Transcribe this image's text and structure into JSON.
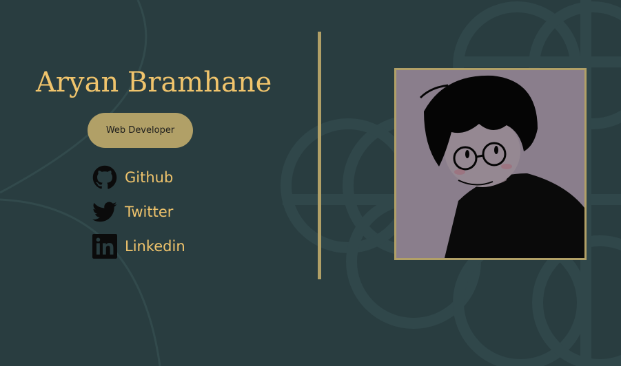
{
  "profile": {
    "name": "Aryan Bramhane",
    "role": "Web Developer"
  },
  "social_links": [
    {
      "label": "Github",
      "icon": "github-icon"
    },
    {
      "label": "Twitter",
      "icon": "twitter-icon"
    },
    {
      "label": "Linkedin",
      "icon": "linkedin-icon"
    }
  ],
  "avatar": {
    "description_icon": "avatar-illustration"
  },
  "colors": {
    "background": "#293d40",
    "accent": "#f0c46c",
    "pill": "#b1a067",
    "pattern": "#32484a"
  }
}
